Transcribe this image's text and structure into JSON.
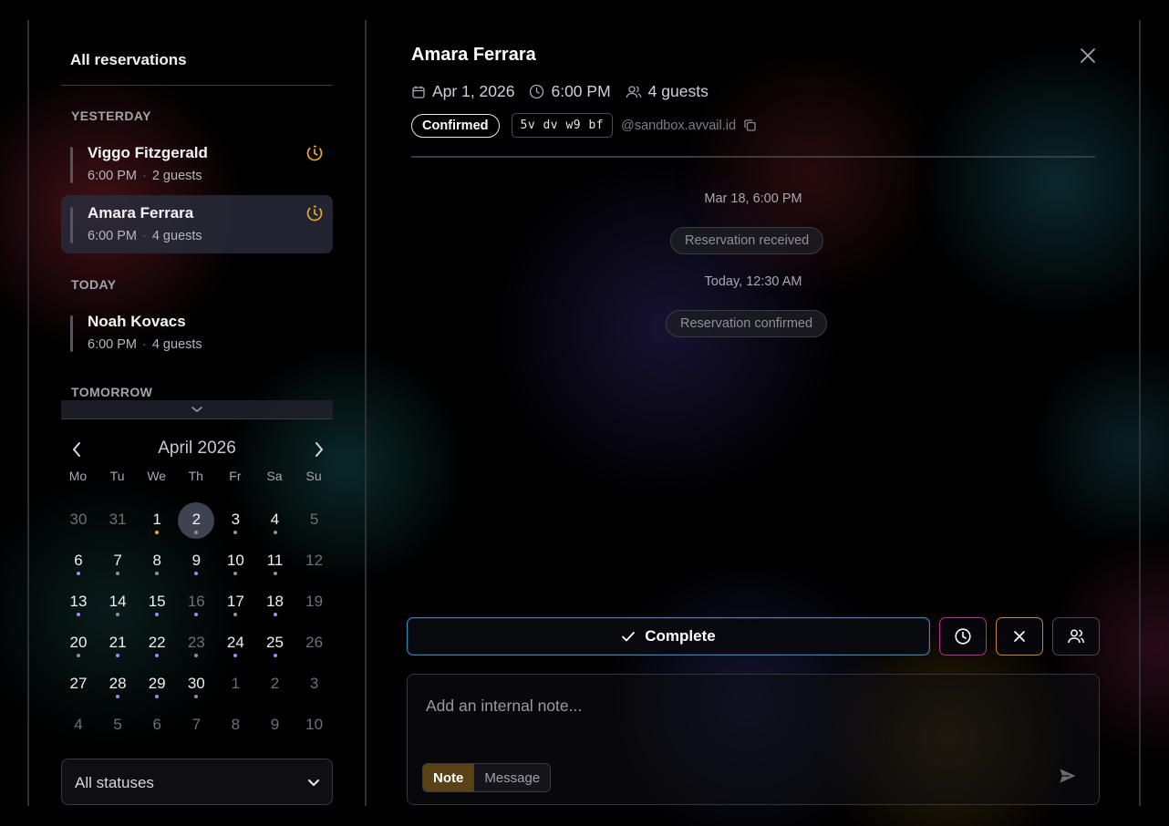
{
  "sidebar": {
    "title": "All reservations",
    "sections": [
      {
        "label": "YESTERDAY",
        "items": [
          {
            "name": "Viggo Fitzgerald",
            "time": "6:00 PM",
            "guests": "2 guests",
            "pending": true,
            "active": false
          },
          {
            "name": "Amara Ferrara",
            "time": "6:00 PM",
            "guests": "4 guests",
            "pending": true,
            "active": true
          }
        ]
      },
      {
        "label": "TODAY",
        "items": [
          {
            "name": "Noah Kovacs",
            "time": "6:00 PM",
            "guests": "4 guests",
            "pending": false,
            "active": false
          }
        ]
      },
      {
        "label": "TOMORROW",
        "items": []
      }
    ]
  },
  "calendar": {
    "month_label": "April 2026",
    "weekdays": [
      "Mo",
      "Tu",
      "We",
      "Th",
      "Fr",
      "Sa",
      "Su"
    ],
    "weeks": [
      [
        {
          "d": "30",
          "dim": true
        },
        {
          "d": "31",
          "dim": true
        },
        {
          "d": "1",
          "dot": "#e9a92a"
        },
        {
          "d": "2",
          "sel": true,
          "dot": "#8f909a"
        },
        {
          "d": "3",
          "dot": "#8f909a"
        },
        {
          "d": "4",
          "dot": "#8f909a"
        },
        {
          "d": "5",
          "dim": true
        }
      ],
      [
        {
          "d": "6",
          "dot": "#a887f5"
        },
        {
          "d": "7",
          "dot": "#8f909a"
        },
        {
          "d": "8",
          "dot": "#8f909a"
        },
        {
          "d": "9",
          "dot": "#a887f5"
        },
        {
          "d": "10",
          "dot": "#8f909a"
        },
        {
          "d": "11",
          "dot": "#8f909a"
        },
        {
          "d": "12",
          "dim": true
        }
      ],
      [
        {
          "d": "13",
          "dot": "#a887f5"
        },
        {
          "d": "14",
          "dot": "#8f909a"
        },
        {
          "d": "15",
          "dot": "#a887f5"
        },
        {
          "d": "16",
          "dim": true,
          "dot": "#a887f5"
        },
        {
          "d": "17",
          "dot": "#8f909a"
        },
        {
          "d": "18",
          "dot": "#a887f5"
        },
        {
          "d": "19",
          "dim": true
        }
      ],
      [
        {
          "d": "20",
          "dot": "#8f909a"
        },
        {
          "d": "21",
          "dot": "#a887f5"
        },
        {
          "d": "22",
          "dot": "#a887f5"
        },
        {
          "d": "23",
          "dim": true,
          "dot": "#8f909a"
        },
        {
          "d": "24",
          "dot": "#a887f5"
        },
        {
          "d": "25",
          "dot": "#a887f5"
        },
        {
          "d": "26",
          "dim": true
        }
      ],
      [
        {
          "d": "27"
        },
        {
          "d": "28",
          "dot": "#a887f5"
        },
        {
          "d": "29",
          "dot": "#a887f5"
        },
        {
          "d": "30",
          "dot": "#8f909a"
        },
        {
          "d": "1",
          "dim": true
        },
        {
          "d": "2",
          "dim": true
        },
        {
          "d": "3",
          "dim": true
        }
      ],
      [
        {
          "d": "4",
          "dim": true
        },
        {
          "d": "5",
          "dim": true
        },
        {
          "d": "6",
          "dim": true
        },
        {
          "d": "7",
          "dim": true
        },
        {
          "d": "8",
          "dim": true
        },
        {
          "d": "9",
          "dim": true
        },
        {
          "d": "10",
          "dim": true
        }
      ]
    ]
  },
  "status_filter": {
    "selected": "All statuses"
  },
  "detail": {
    "name": "Amara Ferrara",
    "date": "Apr 1, 2026",
    "time": "6:00 PM",
    "guests": "4 guests",
    "status": "Confirmed",
    "code": "5v dv w9 bf",
    "email": "@sandbox.avvail.id"
  },
  "timeline": [
    {
      "time": "Mar 18, 6:00 PM",
      "event": "Reservation received"
    },
    {
      "time": "Today, 12:30 AM",
      "event": "Reservation confirmed"
    }
  ],
  "actions": {
    "complete_label": "Complete"
  },
  "note": {
    "placeholder": "Add an internal note...",
    "mode_note": "Note",
    "mode_message": "Message"
  },
  "colors": {
    "pending_icon": "#e9a92a",
    "note_active": "#5a4217",
    "complete_border": "#2a8ab0",
    "clock_btn_border": "#c0289c",
    "cancel_btn_border": "#c9872d"
  }
}
